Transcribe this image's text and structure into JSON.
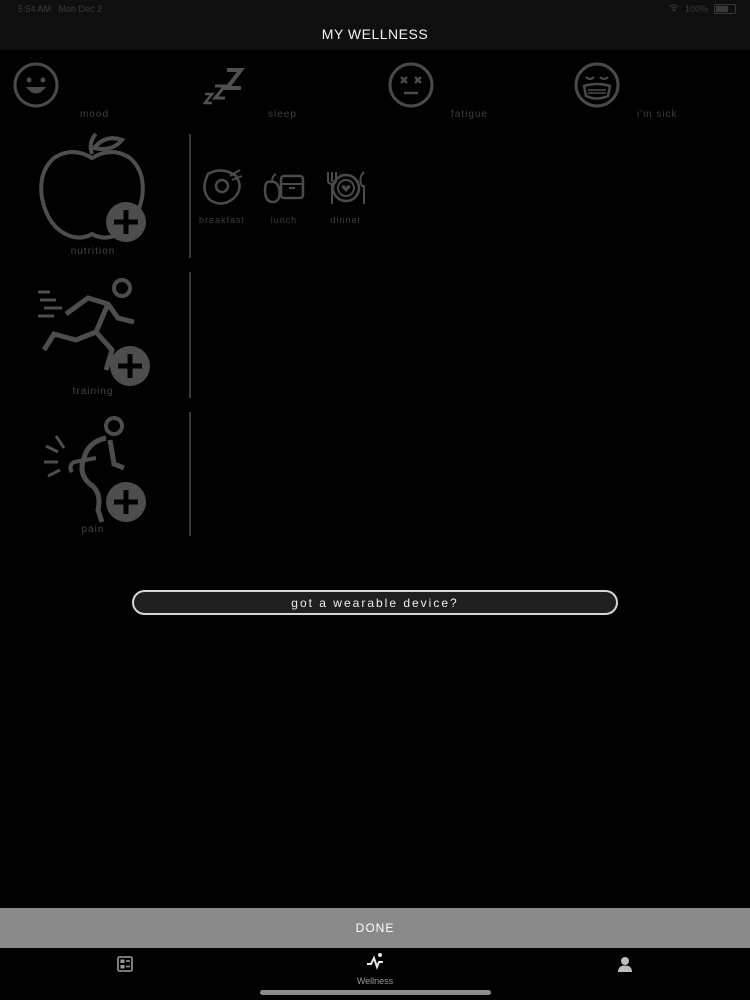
{
  "statusbar": {
    "time": "5:54 AM",
    "date": "Mon Dec 2",
    "battery": "100%"
  },
  "header": {
    "title": "MY WELLNESS"
  },
  "status_items": [
    {
      "label": "mood",
      "icon": "smile-face-icon"
    },
    {
      "label": "sleep",
      "icon": "sleep-zzz-icon"
    },
    {
      "label": "fatigue",
      "icon": "tired-face-icon"
    },
    {
      "label": "i'm sick",
      "icon": "mask-face-icon"
    }
  ],
  "sections": {
    "nutrition": {
      "label": "nutrition",
      "icon": "apple-add-icon",
      "meals": [
        {
          "label": "breakfast",
          "icon": "breakfast-egg-icon"
        },
        {
          "label": "lunch",
          "icon": "lunchbox-icon"
        },
        {
          "label": "dinner",
          "icon": "dinner-plate-icon"
        }
      ]
    },
    "training": {
      "label": "training",
      "icon": "runner-add-icon"
    },
    "pain": {
      "label": "pain",
      "icon": "pain-body-add-icon"
    }
  },
  "wearable": {
    "label": "got a wearable device?"
  },
  "done": {
    "label": "DONE"
  },
  "tabbar": {
    "tabs": [
      {
        "label": "",
        "icon": "dashboard-icon"
      },
      {
        "label": "Wellness",
        "icon": "wellness-pulse-icon"
      },
      {
        "label": "",
        "icon": "profile-icon"
      }
    ]
  }
}
